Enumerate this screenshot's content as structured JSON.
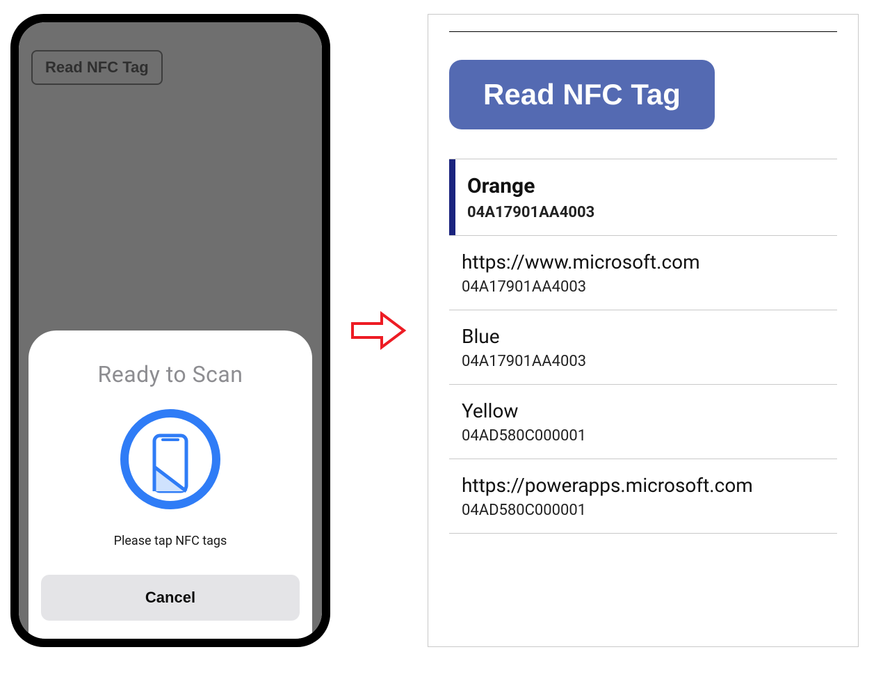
{
  "left": {
    "read_button_label": "Read NFC Tag",
    "sheet": {
      "title": "Ready to Scan",
      "message": "Please tap NFC tags",
      "cancel_label": "Cancel",
      "icon_name": "phone-nfc-icon",
      "icon_color": "#2f7cf6"
    }
  },
  "arrow": {
    "color": "#ed1c24",
    "name": "arrow-right-icon"
  },
  "right": {
    "read_button_label": "Read NFC Tag",
    "button_color": "#546ab2",
    "items": [
      {
        "title": "Orange",
        "sub": "04A17901AA4003",
        "selected": true
      },
      {
        "title": "https://www.microsoft.com",
        "sub": "04A17901AA4003",
        "selected": false
      },
      {
        "title": "Blue",
        "sub": "04A17901AA4003",
        "selected": false
      },
      {
        "title": "Yellow",
        "sub": "04AD580C000001",
        "selected": false
      },
      {
        "title": "https://powerapps.microsoft.com",
        "sub": "04AD580C000001",
        "selected": false
      }
    ]
  }
}
